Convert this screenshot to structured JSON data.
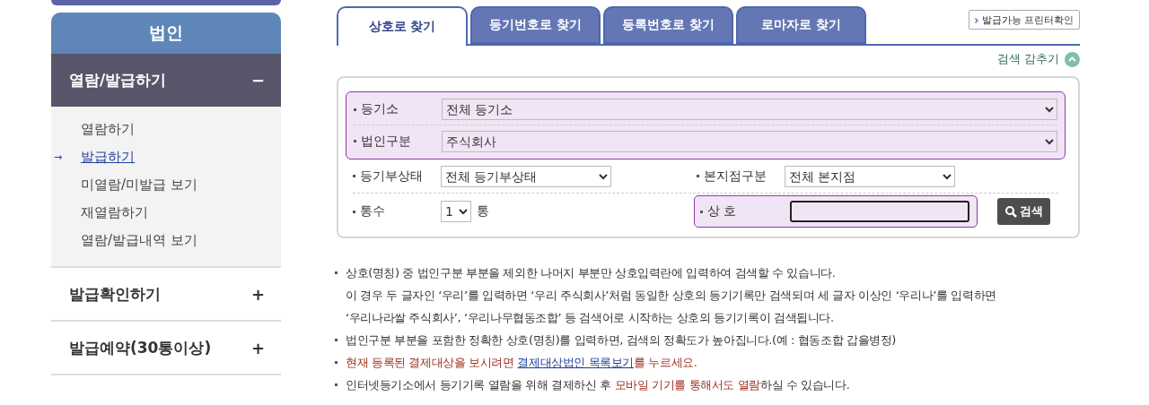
{
  "sidebar": {
    "header": "법인",
    "sections": [
      {
        "label": "열람/발급하기",
        "expanded": true,
        "toggle": "−",
        "children": [
          {
            "label": "열람하기",
            "selected": false
          },
          {
            "label": "발급하기",
            "selected": true,
            "marker": "→"
          },
          {
            "label": "미열람/미발급 보기",
            "selected": false
          },
          {
            "label": "재열람하기",
            "selected": false
          },
          {
            "label": "열람/발급내역 보기",
            "selected": false
          }
        ]
      },
      {
        "label": "발급확인하기",
        "expanded": false,
        "toggle": "+"
      },
      {
        "label": "발급예약(30통이상)",
        "expanded": false,
        "toggle": "+"
      }
    ]
  },
  "tabs": [
    {
      "label": "상호로 찾기",
      "selected": true
    },
    {
      "label": "등기번호로 찾기",
      "selected": false
    },
    {
      "label": "등록번호로 찾기",
      "selected": false
    },
    {
      "label": "로마자로 찾기",
      "selected": false
    }
  ],
  "printer_button": "발급가능 프린터확인",
  "hide_search": "검색 감추기",
  "form": {
    "registry": {
      "label": "등기소",
      "value": "전체 등기소"
    },
    "corp_type": {
      "label": "법인구분",
      "value": "주식회사"
    },
    "status": {
      "label": "등기부상태",
      "value": "전체 등기부상태"
    },
    "branch": {
      "label": "본지점구분",
      "value": "전체 본지점"
    },
    "copies": {
      "label": "통수",
      "value": "1",
      "unit": "통"
    },
    "name": {
      "label": "상 호"
    },
    "search_button": "검색"
  },
  "notes": [
    {
      "kind": "bullet",
      "parts": [
        {
          "kind": "plain",
          "text": "상호(명칭) 중 법인구분 부분을 제외한 나머지 부분만 상호입력란에 입력하여 검색할 수 있습니다."
        }
      ]
    },
    {
      "kind": "continuation",
      "parts": [
        {
          "kind": "plain",
          "text": "이 경우 두 글자인 ‘우리’를 입력하면 ‘우리 주식회사’처럼 동일한 상호의 등기기록만 검색되며 세 글자 이상인 ‘우리나’를 입력하면"
        }
      ]
    },
    {
      "kind": "continuation",
      "parts": [
        {
          "kind": "plain",
          "text": "‘우리나라쌀 주식회사’, ‘우리나무협동조합’ 등 검색어로 시작하는 상호의 등기기록이 검색됩니다."
        }
      ]
    },
    {
      "kind": "bullet",
      "parts": [
        {
          "kind": "plain",
          "text": "법인구분 부분을 포함한 정확한 상호(명칭)를 입력하면, 검색의 정확도가 높아집니다.(예 : 협동조합 갑을병정)"
        }
      ]
    },
    {
      "kind": "bullet",
      "parts": [
        {
          "kind": "red",
          "text": "현재 등록된 결제대상을 보시려면 "
        },
        {
          "kind": "link",
          "text": "결제대상법인 목록보기"
        },
        {
          "kind": "red",
          "text": "를 누르세요."
        }
      ]
    },
    {
      "kind": "bullet",
      "parts": [
        {
          "kind": "plain",
          "text": "인터넷등기소에서 등기기록 열람을 위해 결제하신 후 "
        },
        {
          "kind": "red",
          "text": "모바일 기기를 통해서도 열람"
        },
        {
          "kind": "plain",
          "text": "하실 수 있습니다."
        }
      ]
    }
  ]
}
